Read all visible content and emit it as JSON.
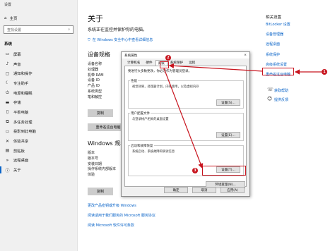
{
  "window": {
    "title": "设置"
  },
  "sidebar": {
    "home_label": "主页",
    "search_placeholder": "查找设置",
    "section": "系统",
    "items": [
      {
        "label": "屏幕",
        "icon": "display-icon"
      },
      {
        "label": "声音",
        "icon": "sound-icon"
      },
      {
        "label": "通知和操作",
        "icon": "notification-icon"
      },
      {
        "label": "专注助手",
        "icon": "focus-assist-icon"
      },
      {
        "label": "电源和睡眠",
        "icon": "power-icon"
      },
      {
        "label": "存储",
        "icon": "storage-icon"
      },
      {
        "label": "平板电脑",
        "icon": "tablet-icon"
      },
      {
        "label": "多任务处理",
        "icon": "multitasking-icon"
      },
      {
        "label": "投影到此电脑",
        "icon": "projecting-icon"
      },
      {
        "label": "体验共享",
        "icon": "shared-experiences-icon"
      },
      {
        "label": "剪贴板",
        "icon": "clipboard-icon"
      },
      {
        "label": "远程桌面",
        "icon": "remote-desktop-icon"
      },
      {
        "label": "关于",
        "icon": "about-icon"
      }
    ]
  },
  "main": {
    "title": "关于",
    "status": "系统正在监控并保护你的电脑。",
    "status_link": "在 Windows 安全中心中查看详细信息",
    "device_spec_heading": "设备规格",
    "device_spec_rows": [
      "设备名称",
      "处理器",
      "机带 RAM",
      "设备 ID",
      "产品 ID",
      "系统类型",
      "笔和触控"
    ],
    "copy_button": "复制",
    "rename_button": "重命名这台电脑",
    "windows_spec_heading": "Windows 规格",
    "windows_spec_rows": [
      "版本",
      "版本号",
      "安装日期",
      "操作系统内部版本",
      "体验"
    ],
    "copy_button2": "复制",
    "bottom_links": [
      "更改产品密钥或升级 Windows",
      "阅读适用于我们服务的 Microsoft 服务协议",
      "阅读 Microsoft 软件许可条款"
    ]
  },
  "related": {
    "heading": "相关设置",
    "links": [
      "BitLocker 设置",
      "设备管理器",
      "远程桌面",
      "系统保护",
      "高级系统设置",
      "重命名这台电脑"
    ],
    "help_links": [
      "获取帮助",
      "提供反馈"
    ]
  },
  "dialog": {
    "title": "系统属性",
    "close": "×",
    "tabs": [
      "计算机名",
      "硬件",
      "高级",
      "系统保护",
      "远程"
    ],
    "active_tab": 2,
    "note": "要进行大多数更改，你必须作为管理员登录。",
    "groups": [
      {
        "title": "性能",
        "text": "视觉效果，处理器计划，内存使用，以及虚拟内存",
        "button": "设置(S)..."
      },
      {
        "title": "用户配置文件",
        "text": "与登录帐户相关的桌面设置",
        "button": "设置(E)..."
      },
      {
        "title": "启动和故障恢复",
        "text": "系统启动、系统故障和调试信息",
        "button": "设置(T)..."
      }
    ],
    "env_button": "环境变量(N)...",
    "footer": {
      "ok": "确定",
      "cancel": "取消",
      "apply": "应用(A)"
    }
  },
  "annotations": {
    "m1": "1",
    "m2": "2",
    "m3": "3",
    "color": "#c8141e"
  },
  "colors": {
    "accent": "#0a64c8",
    "sidebar_bg": "#f0f0f0"
  }
}
